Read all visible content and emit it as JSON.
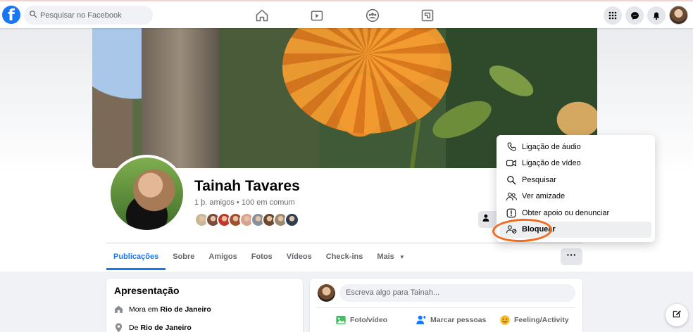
{
  "topbar": {
    "logo_letter": "f",
    "search_placeholder": "Pesquisar no Facebook",
    "nav_icons": [
      "home-icon",
      "watch-icon",
      "groups-icon",
      "gaming-icon"
    ],
    "right_icons": [
      "menu-grid-icon",
      "messenger-icon",
      "notifications-icon"
    ]
  },
  "profile": {
    "name": "Tainah Tavares",
    "friends_line": "1 þ. amigos • 100 em comum",
    "friend_face_colors": [
      "#c9b79a",
      "#7a4a3a",
      "#c0392b",
      "#a0522d",
      "#d8a48f",
      "#8a8f99",
      "#6b4a30",
      "#9a8a70",
      "#2c3e50"
    ]
  },
  "tabs": [
    {
      "label": "Publicações",
      "active": true
    },
    {
      "label": "Sobre",
      "active": false
    },
    {
      "label": "Amigos",
      "active": false
    },
    {
      "label": "Fotos",
      "active": false
    },
    {
      "label": "Vídeos",
      "active": false
    },
    {
      "label": "Check-ins",
      "active": false
    },
    {
      "label": "Mais",
      "active": false
    }
  ],
  "more_button": "···",
  "menu": {
    "items": [
      {
        "label": "Ligação de áudio",
        "icon": "phone-icon"
      },
      {
        "label": "Ligação de vídeo",
        "icon": "video-camera-icon"
      },
      {
        "label": "Pesquisar",
        "icon": "search-icon"
      },
      {
        "label": "Ver amizade",
        "icon": "friendship-icon"
      },
      {
        "label": "Obter apoio ou denunciar",
        "icon": "report-icon"
      },
      {
        "label": "Bloquear",
        "icon": "block-user-icon",
        "highlighted": true
      }
    ],
    "annotation_color": "#f26a1b"
  },
  "intro": {
    "title": "Apresentação",
    "lives_prefix": "Mora em",
    "lives_city": "Rio de Janeiro",
    "from_prefix": "De",
    "from_city": "Rio de Janeiro"
  },
  "composer": {
    "placeholder": "Escreva algo para Tainah...",
    "actions": [
      {
        "label": "Foto/vídeo",
        "icon": "photo-icon",
        "color": "#45bd62"
      },
      {
        "label": "Marcar pessoas",
        "icon": "tag-people-icon",
        "color": "#1877f2"
      },
      {
        "label": "Feeling/Activity",
        "icon": "feeling-icon",
        "color": "#f7b928"
      }
    ]
  },
  "colors": {
    "brand": "#1877f2",
    "annotation": "#f26a1b"
  }
}
